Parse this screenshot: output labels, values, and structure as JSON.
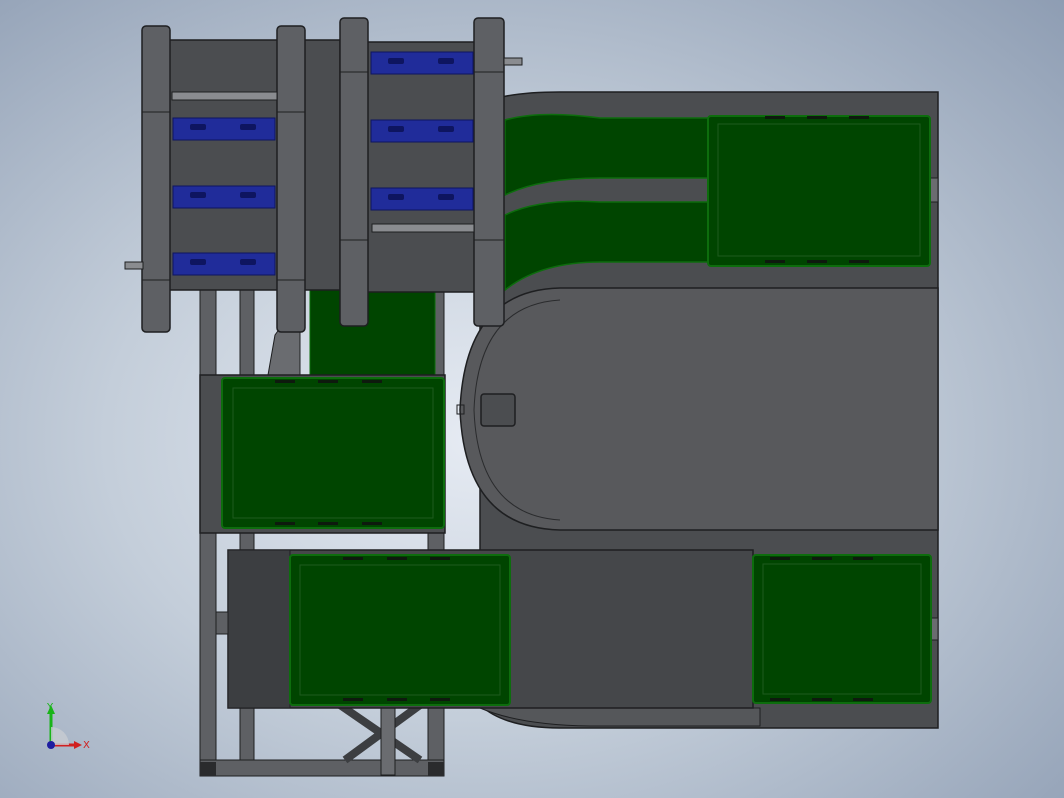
{
  "viewport": {
    "background_colors": [
      "#e6ebf3",
      "#c4ceda",
      "#8e9db3"
    ]
  },
  "model": {
    "colors": {
      "frame": "#4b4d50",
      "frame_dark": "#3c3e41",
      "frame_edge": "#1e1f21",
      "steel": "#5e6064",
      "tray": "#004500",
      "tray_edge": "#0d6d0d",
      "chain": "#202c9a",
      "chain_dark": "#0e1560",
      "rod": "#8a8c90"
    }
  },
  "triad": {
    "y_label": "Y",
    "x_label": "X",
    "y_color": "#19b419",
    "x_color": "#d02020",
    "z_color": "#1e1ea0"
  }
}
